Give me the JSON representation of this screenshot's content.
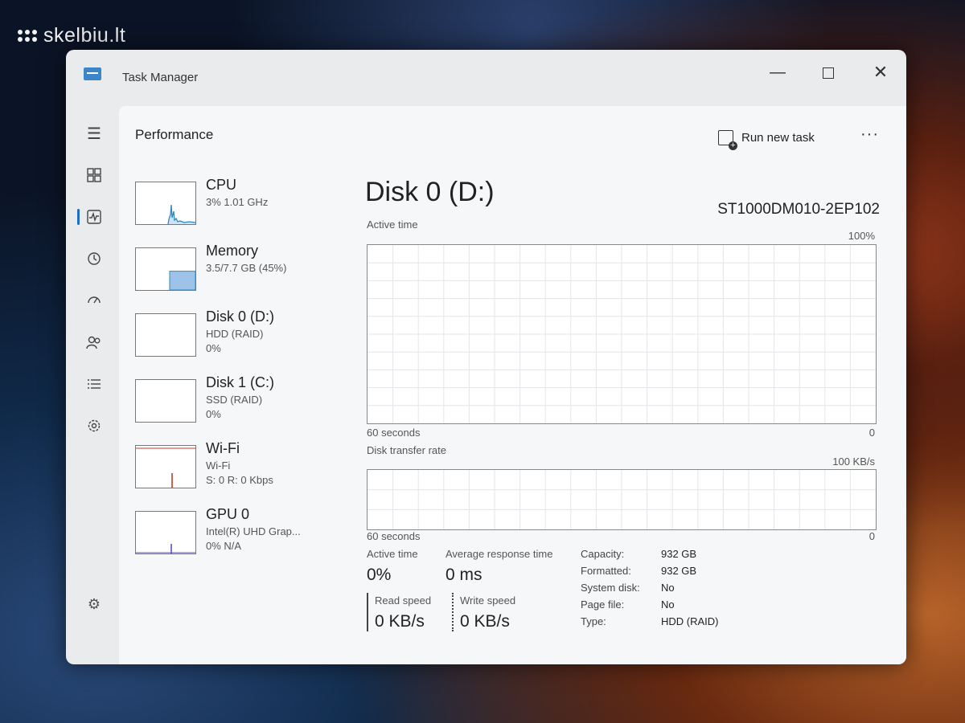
{
  "watermark": {
    "text": "skelbiu.lt"
  },
  "window": {
    "title": "Task Manager"
  },
  "header": {
    "page_title": "Performance",
    "run_new_task": "Run new task",
    "more": "···"
  },
  "nav": {
    "items": [
      "hamburger-menu",
      "processes",
      "performance",
      "app-history",
      "startup-apps",
      "users",
      "details",
      "services"
    ],
    "active": "performance"
  },
  "perf_items": [
    {
      "name": "CPU",
      "sub1": "3% 1.01 GHz",
      "sub2": ""
    },
    {
      "name": "Memory",
      "sub1": "3.5/7.7 GB (45%)",
      "sub2": "",
      "fill_fraction": 0.45
    },
    {
      "name": "Disk 0 (D:)",
      "sub1": "HDD (RAID)",
      "sub2": "0%"
    },
    {
      "name": "Disk 1 (C:)",
      "sub1": "SSD (RAID)",
      "sub2": "0%"
    },
    {
      "name": "Wi-Fi",
      "sub1": "Wi-Fi",
      "sub2": "S: 0 R: 0 Kbps"
    },
    {
      "name": "GPU 0",
      "sub1": "Intel(R) UHD Grap...",
      "sub2": "0% N/A"
    }
  ],
  "disk": {
    "title": "Disk 0 (D:)",
    "model": "ST1000DM010-2EP102",
    "active_time_graph": {
      "label": "Active time",
      "max": "100%",
      "min": "0",
      "duration": "60 seconds"
    },
    "transfer_graph": {
      "label": "Disk transfer rate",
      "max": "100 KB/s",
      "min": "0",
      "duration": "60 seconds"
    }
  },
  "stats": {
    "active_time_label": "Active time",
    "active_time_value": "0%",
    "avg_response_label": "Average response time",
    "avg_response_value": "0 ms",
    "read_speed_label": "Read speed",
    "read_speed_value": "0 KB/s",
    "write_speed_label": "Write speed",
    "write_speed_value": "0 KB/s"
  },
  "properties": [
    {
      "key": "Capacity:",
      "value": "932 GB"
    },
    {
      "key": "Formatted:",
      "value": "932 GB"
    },
    {
      "key": "System disk:",
      "value": "No"
    },
    {
      "key": "Page file:",
      "value": "No"
    },
    {
      "key": "Type:",
      "value": "HDD (RAID)"
    }
  ],
  "colors": {
    "accent": "#1f6fc5",
    "cpu_line": "#2e8ac7",
    "memory_fill": "#9ec3e8",
    "wifi_spike": "#c0392b",
    "gpu_spike": "#5b4fc4",
    "grid": "#e3e6ea"
  }
}
